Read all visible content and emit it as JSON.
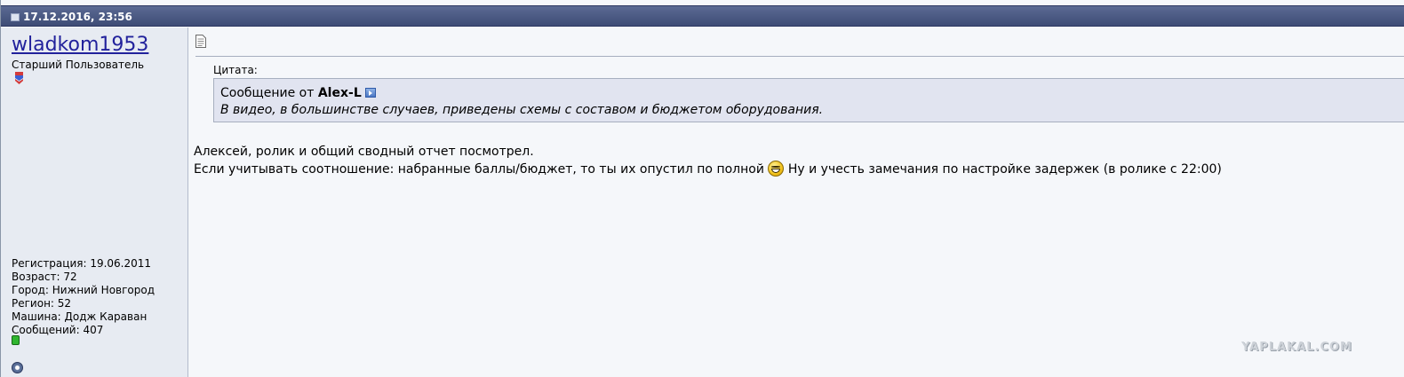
{
  "post": {
    "date": "17.12.2016, 23:56"
  },
  "user": {
    "name": "wladkom1953",
    "title": "Старший Пользователь",
    "info": [
      "Регистрация: 19.06.2011",
      "Возраст: 72",
      "Город: Нижний Новгород",
      "Регион: 52",
      "Машина: Додж Караван",
      "Сообщений: 407"
    ],
    "online_status_color": "#2fb52f"
  },
  "quote": {
    "label": "Цитата:",
    "from_prefix": "Сообщение от",
    "author": "Alex-L",
    "text": "В видео, в большинстве случаев, приведены схемы с составом и бюджетом оборудования."
  },
  "body": {
    "line1": "Алексей, ролик и общий сводный отчет посмотрел.",
    "line2_before_smiley": "Если учитывать соотношение: набранные баллы/бюджет, то ты их опустил по полной",
    "line2_after_smiley": "Ну и учесть замечания по настройке задержек (в ролике с 22:00)"
  },
  "watermark": "YAPLAKAL.COM",
  "icons": {
    "post": "post-icon",
    "rank": "rank-chevron-icon",
    "document": "document-icon",
    "quote_link": "arrow-right-icon",
    "smiley": "laughing-smiley-icon",
    "profile": "profile-icon",
    "online": "online-status-icon"
  },
  "colors": {
    "header": "#3e4c76",
    "username": "#22229c",
    "quote_background": "#e1e4f0",
    "user_column": "#e7ebf2"
  }
}
